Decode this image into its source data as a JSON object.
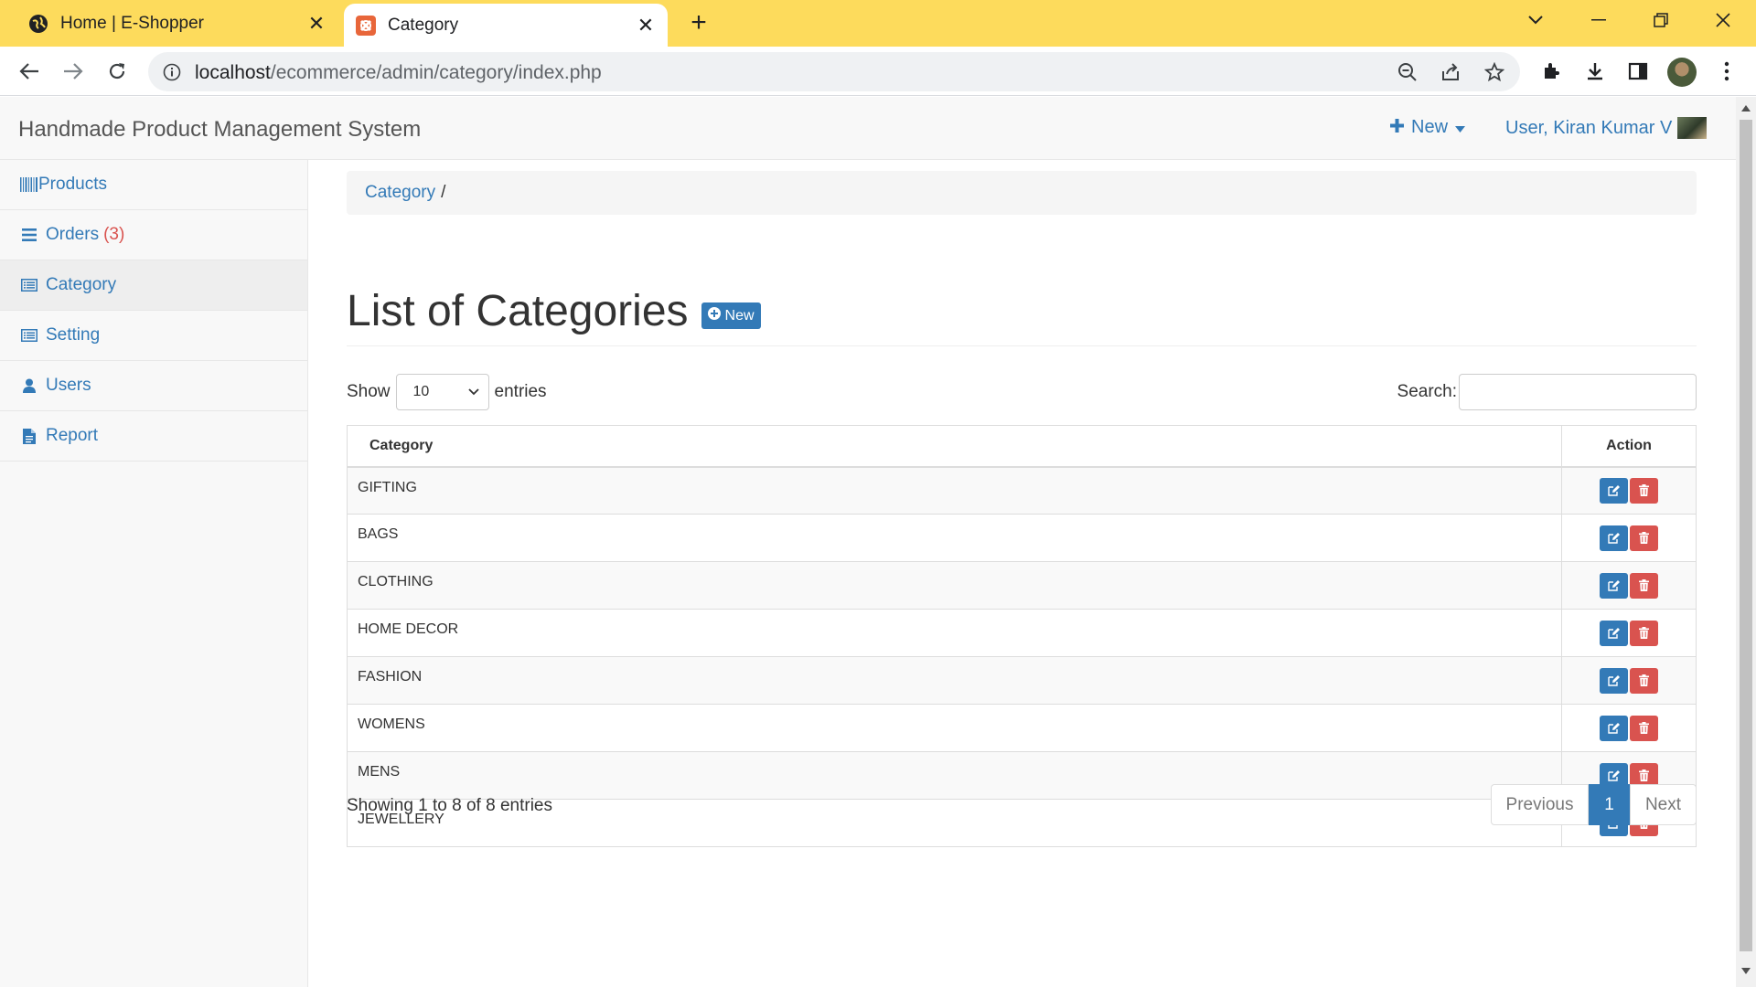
{
  "browser": {
    "tabs": [
      {
        "title": "Home | E-Shopper",
        "active": false
      },
      {
        "title": "Category",
        "active": true
      }
    ],
    "url_host": "localhost",
    "url_path": "/ecommerce/admin/category/index.php"
  },
  "navbar": {
    "brand": "Handmade Product Management System",
    "new_label": "New",
    "user_label": "User, Kiran Kumar V"
  },
  "sidebar": {
    "items": [
      {
        "label": "Products",
        "icon": "barcode-icon"
      },
      {
        "label": "Orders",
        "count": "(3)",
        "icon": "list-icon"
      },
      {
        "label": "Category",
        "icon": "list-alt-icon",
        "active": true
      },
      {
        "label": "Setting",
        "icon": "list-alt-icon"
      },
      {
        "label": "Users",
        "icon": "user-icon"
      },
      {
        "label": "Report",
        "icon": "file-icon"
      }
    ]
  },
  "breadcrumb": {
    "item": "Category",
    "separator": "/"
  },
  "page": {
    "title": "List of Categories",
    "new_button": "New"
  },
  "table_controls": {
    "show_label": "Show",
    "entries_value": "10",
    "entries_label": "entries",
    "search_label": "Search:"
  },
  "table": {
    "headers": [
      "Category",
      "Action"
    ],
    "rows": [
      "GIFTING",
      "BAGS",
      "CLOTHING",
      "HOME DECOR",
      "FASHION",
      "WOMENS",
      "MENS",
      "JEWELLERY"
    ]
  },
  "footer": {
    "info": "Showing 1 to 8 of 8 entries",
    "prev": "Previous",
    "current": "1",
    "next": "Next"
  },
  "colors": {
    "tabbar": "#fddb5c",
    "primary": "#337ab7",
    "danger": "#d9534f"
  }
}
